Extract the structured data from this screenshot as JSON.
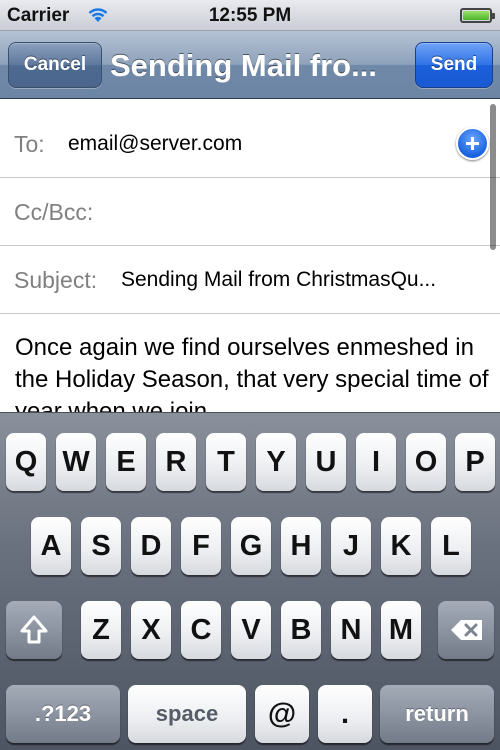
{
  "status_bar": {
    "carrier": "Carrier",
    "time": "12:55 PM",
    "battery_level": 1.0,
    "wifi_icon": "wifi-icon"
  },
  "nav": {
    "cancel_label": "Cancel",
    "title": "Sending Mail fro...",
    "send_label": "Send"
  },
  "fields": {
    "to_label": "To:",
    "to_value": "email@server.com",
    "cc_label": "Cc/Bcc:",
    "subject_label": "Subject:",
    "subject_value": "Sending Mail from ChristmasQu..."
  },
  "body_text": "Once again we find ourselves enmeshed in the Holiday Season, that very special time of year when we join",
  "keyboard": {
    "row1": [
      "Q",
      "W",
      "E",
      "R",
      "T",
      "Y",
      "U",
      "I",
      "O",
      "P"
    ],
    "row2": [
      "A",
      "S",
      "D",
      "F",
      "G",
      "H",
      "J",
      "K",
      "L"
    ],
    "row3": [
      "Z",
      "X",
      "C",
      "V",
      "B",
      "N",
      "M"
    ],
    "numbers_label": ".?123",
    "space_label": "space",
    "at_label": "@",
    "dot_label": ".",
    "return_label": "return",
    "shift_icon": "shift-icon",
    "delete_icon": "delete-icon"
  },
  "colors": {
    "nav_blue": "#6c85a5",
    "send_blue": "#1a5ad2",
    "add_button_blue": "#1a63e0",
    "label_gray": "#808080"
  }
}
